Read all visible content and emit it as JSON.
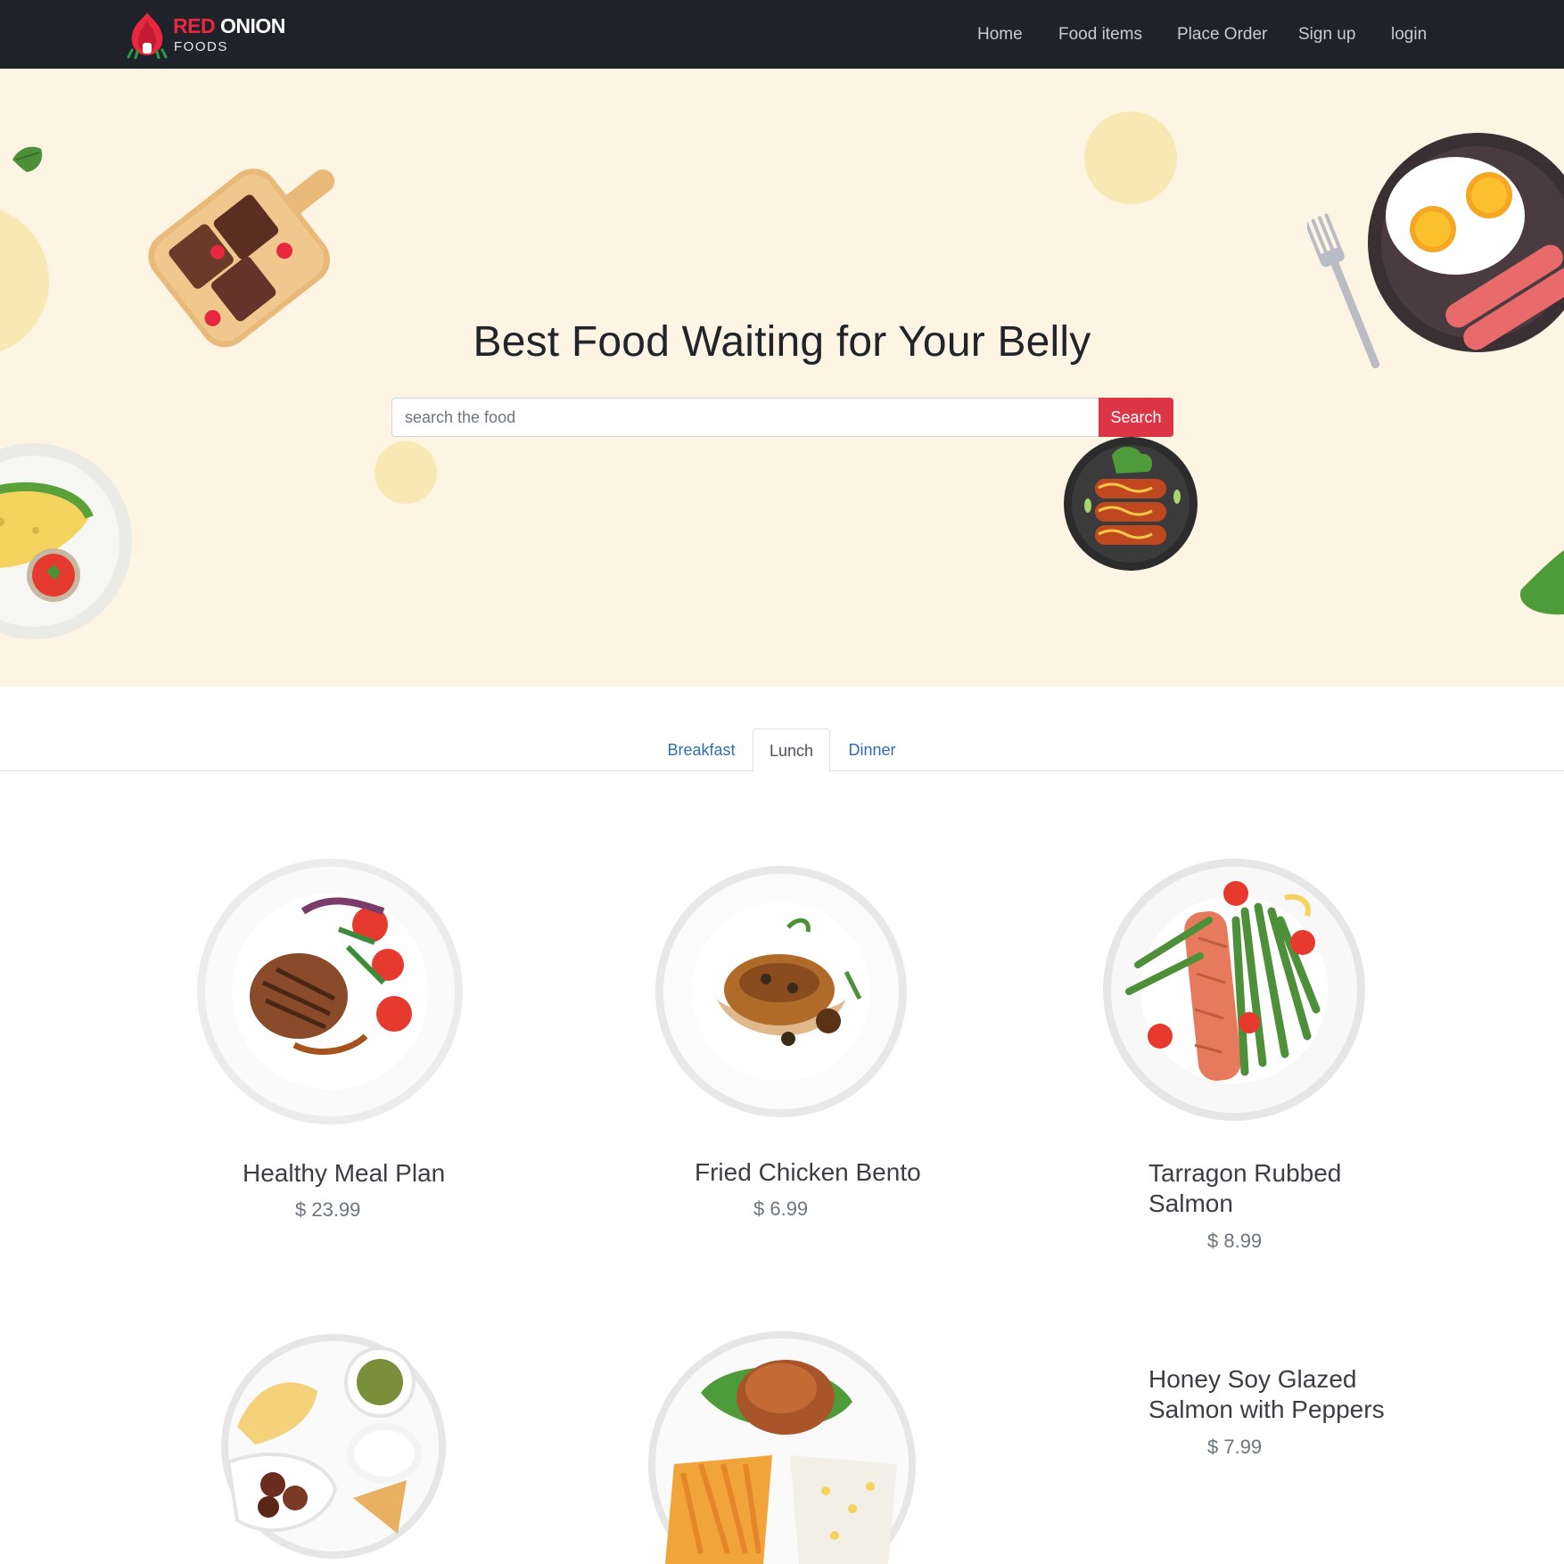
{
  "brand": {
    "name_red": "RED",
    "name_white": "ONION",
    "tagline": "FOODS"
  },
  "nav": {
    "links": [
      "Home",
      "Food items",
      "Place Order",
      "Sign up",
      "login"
    ]
  },
  "hero": {
    "title": "Best Food Waiting for Your Belly",
    "search_placeholder": "search the food",
    "search_button": "Search"
  },
  "tabs": [
    "Breakfast",
    "Lunch",
    "Dinner"
  ],
  "active_tab": "Lunch",
  "foods": [
    {
      "name": "Healthy Meal Plan",
      "price": "$ 23.99"
    },
    {
      "name": "Fried Chicken Bento",
      "price": "$ 6.99"
    },
    {
      "name": "Tarragon Rubbed",
      "name2": "Salmon",
      "price": "$ 8.99"
    },
    {
      "name": "",
      "price": ""
    },
    {
      "name": "",
      "price": ""
    },
    {
      "name": "Honey Soy Glazed",
      "name2": "Salmon with Peppers",
      "price": "$ 7.99"
    }
  ],
  "colors": {
    "navbar": "#1f2229",
    "hero_bg": "#fdf4e3",
    "accent_red": "#dc3545",
    "tab_link": "#2e6db4"
  }
}
